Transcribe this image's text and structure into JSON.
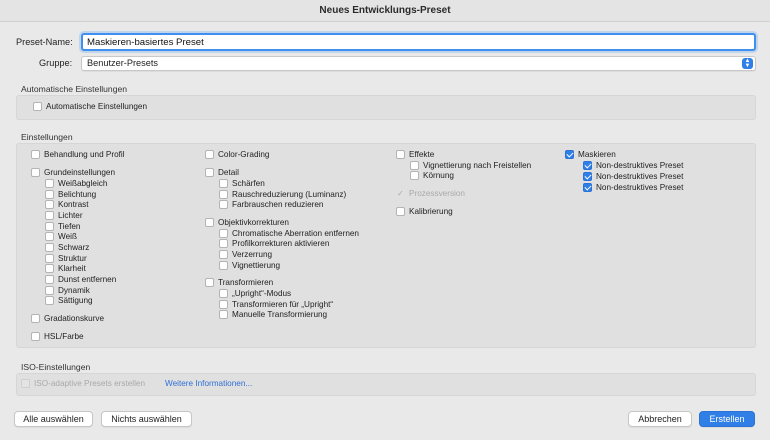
{
  "window": {
    "title": "Neues Entwicklungs-Preset"
  },
  "form": {
    "preset_name_label": "Preset-Name:",
    "preset_name_value": "Maskieren-basiertes Preset",
    "group_label": "Gruppe:",
    "group_value": "Benutzer-Presets"
  },
  "auto": {
    "title": "Automatische Einstellungen",
    "checkbox": "Automatische Einstellungen"
  },
  "settings": {
    "title": "Einstellungen",
    "col1": {
      "behandlung": "Behandlung und Profil",
      "grund": "Grundeinstellungen",
      "grund_items": [
        "Weißabgleich",
        "Belichtung",
        "Kontrast",
        "Lichter",
        "Tiefen",
        "Weiß",
        "Schwarz",
        "Struktur",
        "Klarheit",
        "Dunst entfernen",
        "Dynamik",
        "Sättigung"
      ],
      "gradation": "Gradationskurve",
      "hsl": "HSL/Farbe"
    },
    "col2": {
      "colorgrading": "Color-Grading",
      "detail": "Detail",
      "detail_items": [
        "Schärfen",
        "Rauschreduzierung (Luminanz)",
        "Farbrauschen reduzieren"
      ],
      "objektiv": "Objektivkorrekturen",
      "objektiv_items": [
        "Chromatische Aberration entfernen",
        "Profilkorrekturen aktivieren",
        "Verzerrung",
        "Vignettierung"
      ],
      "transform": "Transformieren",
      "transform_items": [
        "„Upright“-Modus",
        "Transformieren für „Upright“",
        "Manuelle Transformierung"
      ]
    },
    "col3": {
      "effekte": "Effekte",
      "effekte_items": [
        "Vignettierung nach Freistellen",
        "Körnung"
      ],
      "prozess": "Prozessversion",
      "kalibrierung": "Kalibrierung"
    },
    "col4": {
      "maskieren": "Maskieren",
      "mask_items": [
        "Non-destruktives Preset",
        "Non-destruktives Preset",
        "Non-destruktives Preset"
      ]
    }
  },
  "iso": {
    "title": "ISO-Einstellungen",
    "checkbox": "ISO-adaptive Presets erstellen",
    "link": "Weitere Informationen..."
  },
  "buttons": {
    "select_all": "Alle auswählen",
    "select_none": "Nichts auswählen",
    "cancel": "Abbrechen",
    "create": "Erstellen"
  },
  "colors": {
    "accent": "#2f7fe6",
    "background": "#e9e9e9",
    "panel": "#e0e0e0"
  }
}
